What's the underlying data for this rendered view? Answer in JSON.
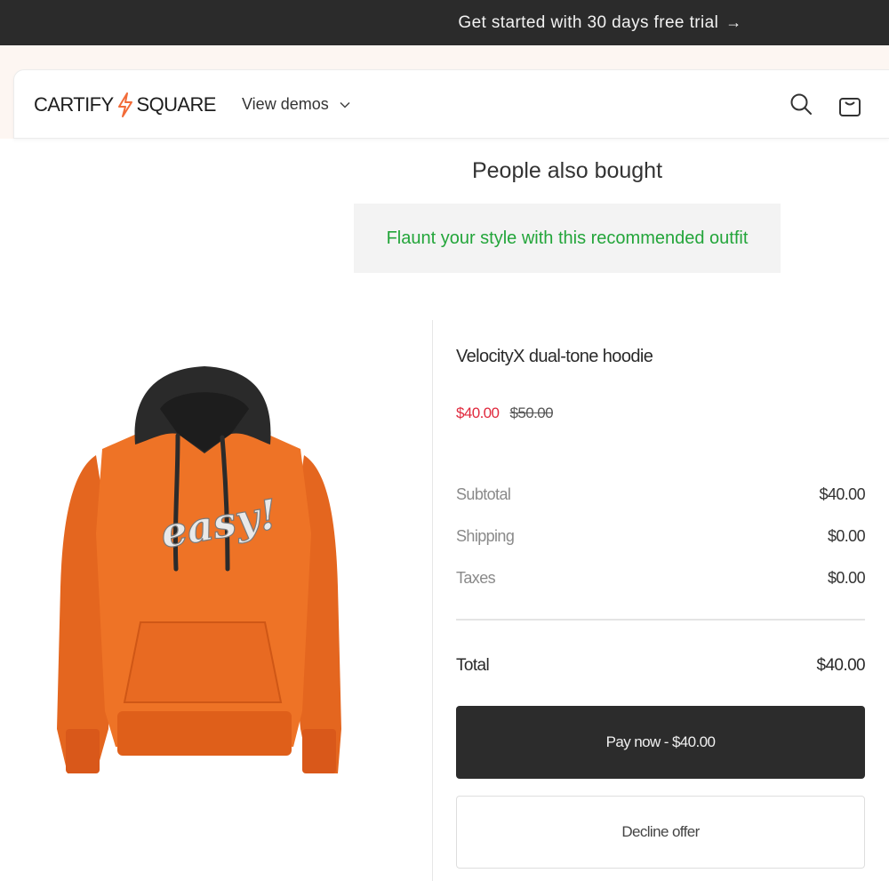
{
  "announcement": {
    "text": "Get started with 30 days free trial",
    "arrow": "→"
  },
  "header": {
    "logo_left": "CARTIFY",
    "logo_right": "SQUARE",
    "nav_label": "View demos",
    "icons": [
      "search-icon",
      "cart-icon",
      "chevron-down-icon",
      "bolt-icon"
    ]
  },
  "recommendation": {
    "title": "People also bought",
    "banner": "Flaunt your style with this recommended outfit"
  },
  "product": {
    "name": "VelocityX dual-tone hoodie",
    "sale_price": "$40.00",
    "original_price": "$50.00",
    "print_text": "easy!"
  },
  "summary": {
    "subtotal_label": "Subtotal",
    "subtotal_value": "$40.00",
    "shipping_label": "Shipping",
    "shipping_value": "$0.00",
    "taxes_label": "Taxes",
    "taxes_value": "$0.00",
    "total_label": "Total",
    "total_value": "$40.00"
  },
  "actions": {
    "pay_label": "Pay now - $40.00",
    "decline_label": "Decline offer"
  },
  "colors": {
    "announce_bg": "#2b2b2b",
    "accent_orange": "#f26b38",
    "banner_green": "#23a53a",
    "sale_red": "#e0293d",
    "button_dark": "#2c2c2c"
  }
}
